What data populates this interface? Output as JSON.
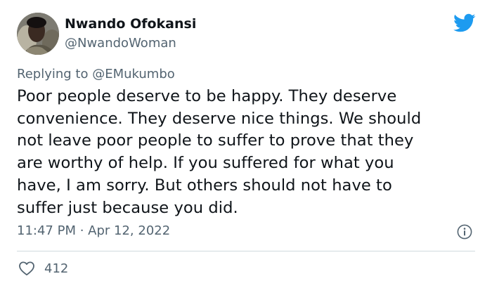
{
  "author": {
    "name": "Nwando Ofokansi",
    "handle": "@NwandoWoman",
    "avatar": "profile-photo"
  },
  "reply": {
    "prefix": "Replying to ",
    "mention": "@EMukumbo"
  },
  "tweet": {
    "lines": [
      "Poor people deserve to be happy. They deserve",
      "convenience. They deserve nice things. We should",
      "not leave poor people to suffer to prove that they",
      "are worthy of help. If you suffered for what you",
      "have, I am sorry. But others should not have to",
      "suffer just because you did."
    ]
  },
  "meta": {
    "time": "11:47 PM",
    "separator": " · ",
    "date": "Apr 12, 2022"
  },
  "stats": {
    "likes": "412"
  },
  "icons": {
    "brand": "twitter-bird-icon",
    "info": "info-icon",
    "like": "heart-icon"
  },
  "colors": {
    "brand_blue": "#1d9bf0",
    "text": "#0f1419",
    "secondary": "#536471",
    "divider": "#cfd9de"
  }
}
